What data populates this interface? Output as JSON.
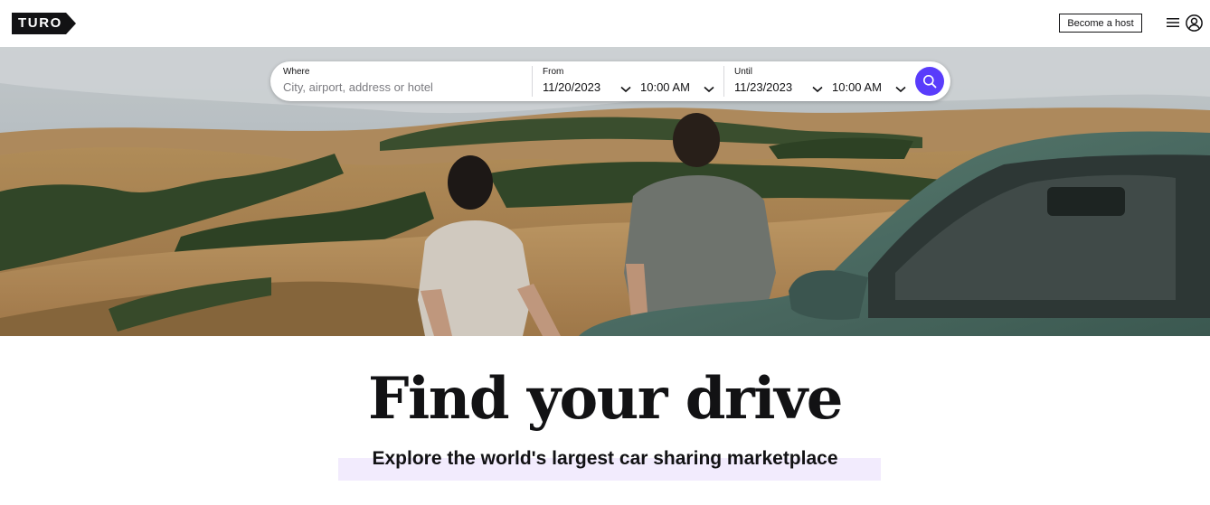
{
  "header": {
    "logo_text": "TURO",
    "host_button": "Become a host",
    "menu_icon": "hamburger-icon",
    "profile_icon": "user-circle-icon"
  },
  "search": {
    "where_label": "Where",
    "where_placeholder": "City, airport, address or hotel",
    "where_value": "",
    "from_label": "From",
    "from_date": "11/20/2023",
    "from_time": "10:00 AM",
    "until_label": "Until",
    "until_date": "11/23/2023",
    "until_time": "10:00 AM",
    "search_icon": "search-icon"
  },
  "hero": {
    "headline": "Find your drive",
    "subheadline": "Explore the world's largest car sharing marketplace"
  },
  "colors": {
    "brand_purple": "#593cfb",
    "text": "#121214",
    "highlight": "#f2ebfd"
  }
}
